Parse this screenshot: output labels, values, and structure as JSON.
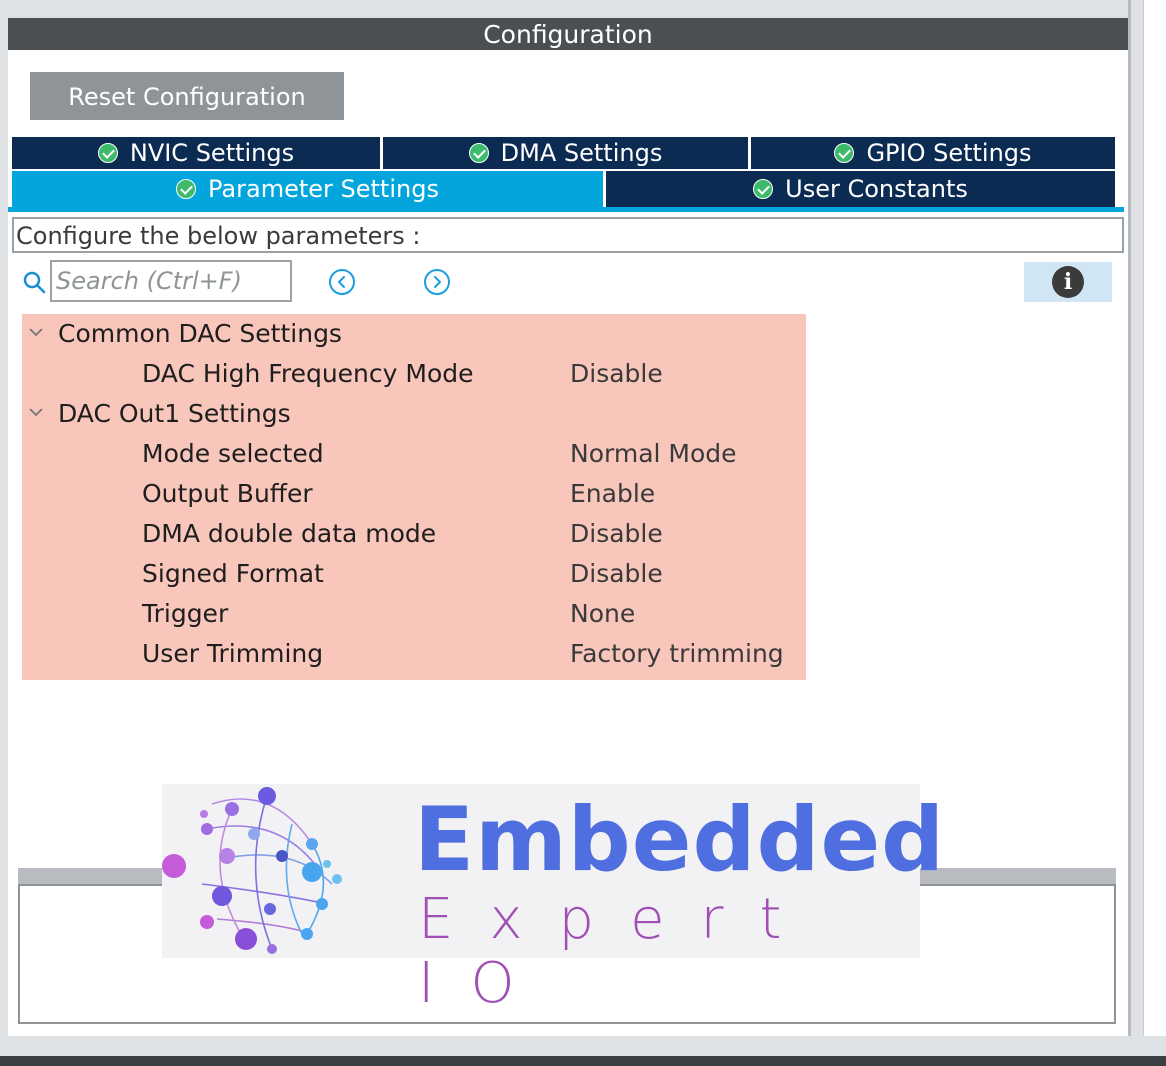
{
  "header": {
    "title": "Configuration"
  },
  "toolbar": {
    "reset_label": "Reset Configuration"
  },
  "tabs": [
    {
      "label": "NVIC Settings",
      "active": false
    },
    {
      "label": "DMA Settings",
      "active": false
    },
    {
      "label": "GPIO Settings",
      "active": false
    },
    {
      "label": "Parameter Settings",
      "active": true
    },
    {
      "label": "User Constants",
      "active": false
    }
  ],
  "panel": {
    "instruction": "Configure the below parameters :"
  },
  "search": {
    "placeholder": "Search (Ctrl+F)",
    "value": ""
  },
  "groups": [
    {
      "label": "Common DAC Settings",
      "params": [
        {
          "name": "DAC High Frequency Mode",
          "value": "Disable"
        }
      ]
    },
    {
      "label": "DAC Out1 Settings",
      "params": [
        {
          "name": "Mode selected",
          "value": "Normal Mode"
        },
        {
          "name": "Output Buffer",
          "value": "Enable"
        },
        {
          "name": "DMA double data mode",
          "value": "Disable"
        },
        {
          "name": "Signed Format",
          "value": "Disable"
        },
        {
          "name": "Trigger",
          "value": "None"
        },
        {
          "name": "User Trimming",
          "value": "Factory trimming"
        }
      ]
    }
  ],
  "watermark": {
    "title": "Embedded",
    "subtitle": "Expert IO"
  },
  "colors": {
    "header_bg": "#4b4f51",
    "tab_bg": "#0c2b52",
    "tab_active_bg": "#03a5dc",
    "check_green": "#3dba6b",
    "highlight": "#f8c6bb",
    "logo_blue": "#4f6ee0",
    "logo_purple": "#a04fb4"
  }
}
